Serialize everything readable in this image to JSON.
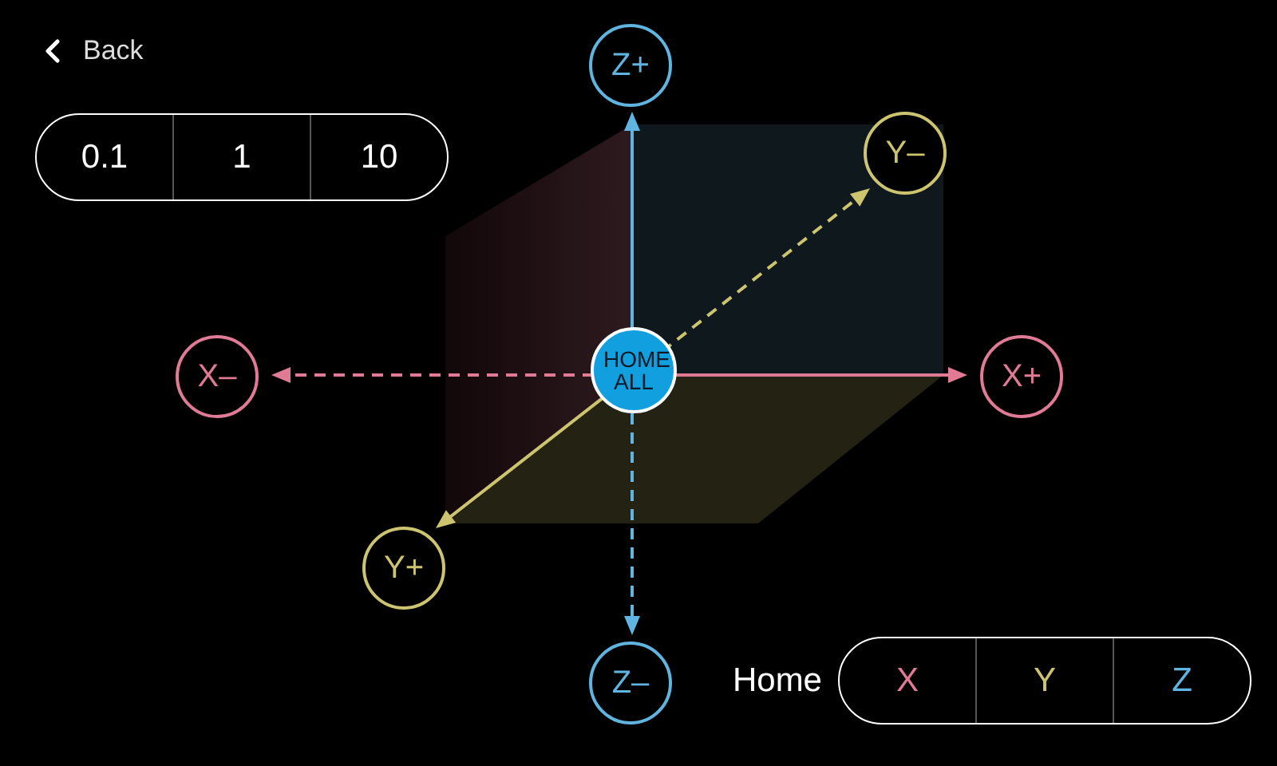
{
  "back": {
    "label": "Back"
  },
  "step_sizes": [
    {
      "label": "0.1"
    },
    {
      "label": "1"
    },
    {
      "label": "10"
    }
  ],
  "jog_buttons": [
    {
      "label": "Z+",
      "color": "#5fb4e0"
    },
    {
      "label": "Y–",
      "color": "#cdc470"
    },
    {
      "label": "X–",
      "color": "#e07a95"
    },
    {
      "label": "X+",
      "color": "#e07a95"
    },
    {
      "label": "Y+",
      "color": "#cdc470"
    },
    {
      "label": "Z–",
      "color": "#5fb4e0"
    }
  ],
  "home_all": {
    "label": "HOME ALL"
  },
  "home": {
    "label": "Home",
    "axes": [
      {
        "label": "X",
        "color": "#e07a95"
      },
      {
        "label": "Y",
        "color": "#cdc470"
      },
      {
        "label": "Z",
        "color": "#5fb4e0"
      }
    ]
  }
}
